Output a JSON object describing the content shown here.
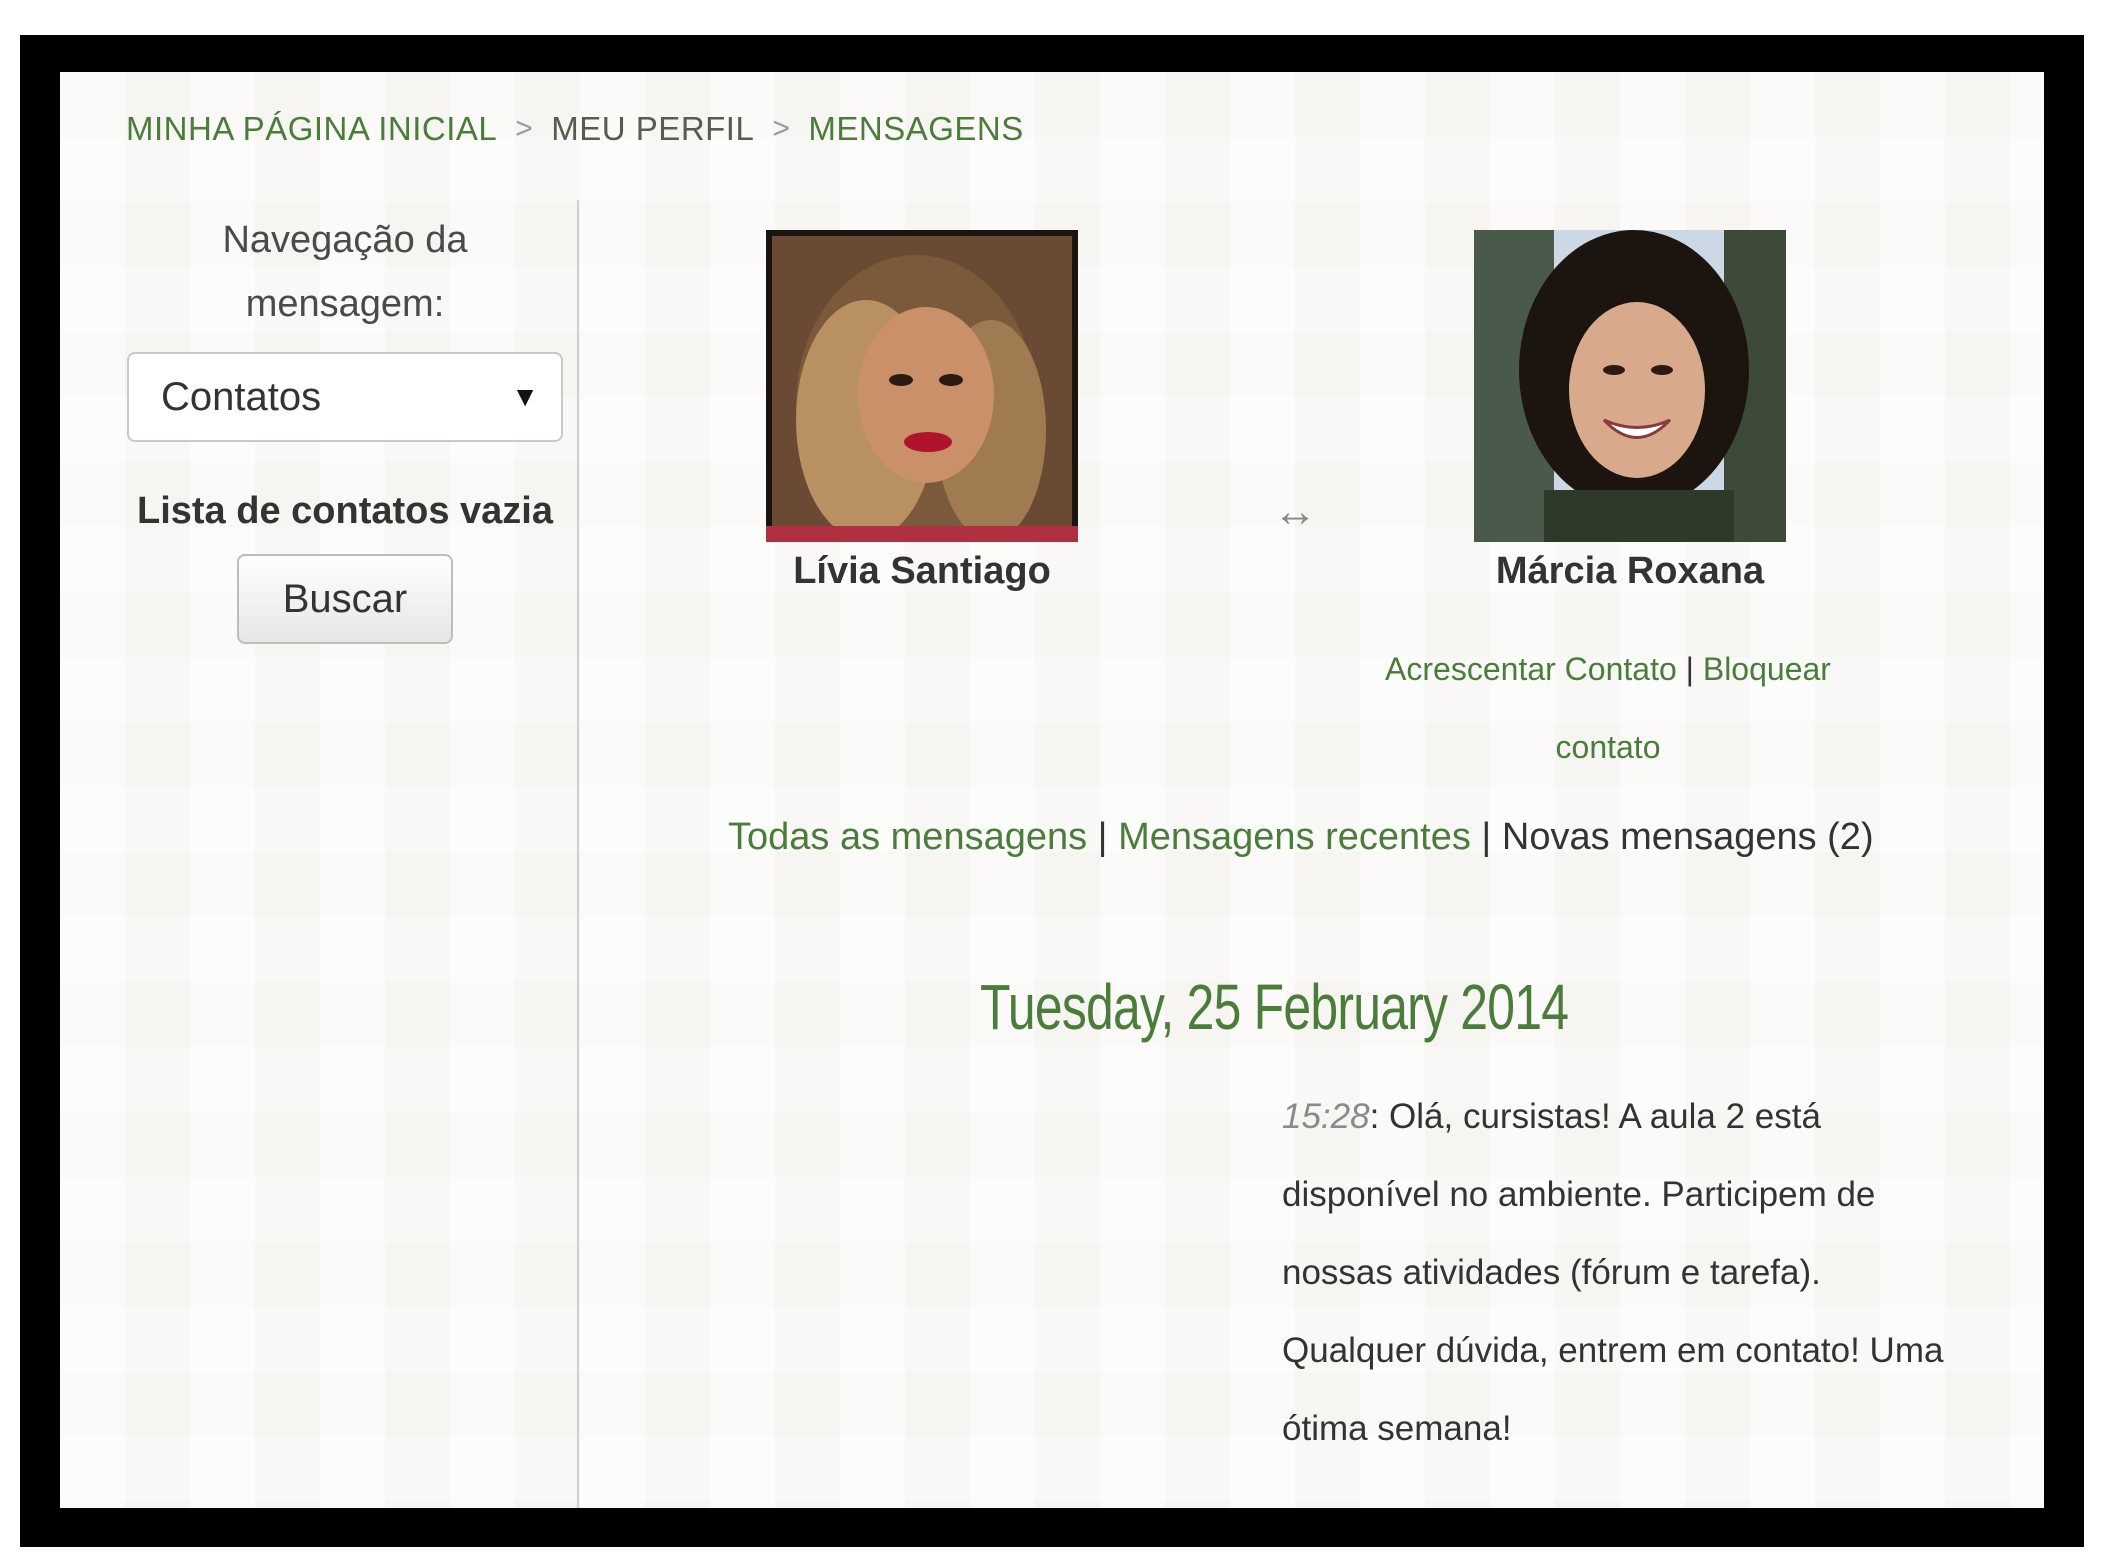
{
  "breadcrumb": {
    "home": "MINHA PÁGINA INICIAL",
    "profile": "MEU PERFIL",
    "current": "MENSAGENS",
    "separator": ">"
  },
  "sidebar": {
    "nav_title": "Navegação da mensagem:",
    "select_value": "Contatos",
    "empty_list": "Lista de contatos vazia",
    "search_button": "Buscar"
  },
  "conversation": {
    "user_left": {
      "name": "Lívia Santiago"
    },
    "user_right": {
      "name": "Márcia Roxana"
    },
    "swap_icon": "↔",
    "actions": {
      "add_contact": "Acrescentar Contato",
      "separator": " | ",
      "block_contact": "Bloquear contato"
    }
  },
  "message_nav": {
    "all": "Todas as mensagens",
    "recent": "Mensagens recentes",
    "new": "Novas mensagens (2)",
    "separator": " | "
  },
  "messages": {
    "date": "Tuesday, 25 February 2014",
    "items": [
      {
        "time": "15:28",
        "text": ": Olá, cursistas! A aula 2 está disponível no ambiente. Participem de nossas atividades (fórum e tarefa). Qualquer dúvida, entrem em contato! Uma ótima semana!"
      }
    ]
  },
  "colors": {
    "link": "#4a7d3a",
    "frame": "#000000"
  }
}
